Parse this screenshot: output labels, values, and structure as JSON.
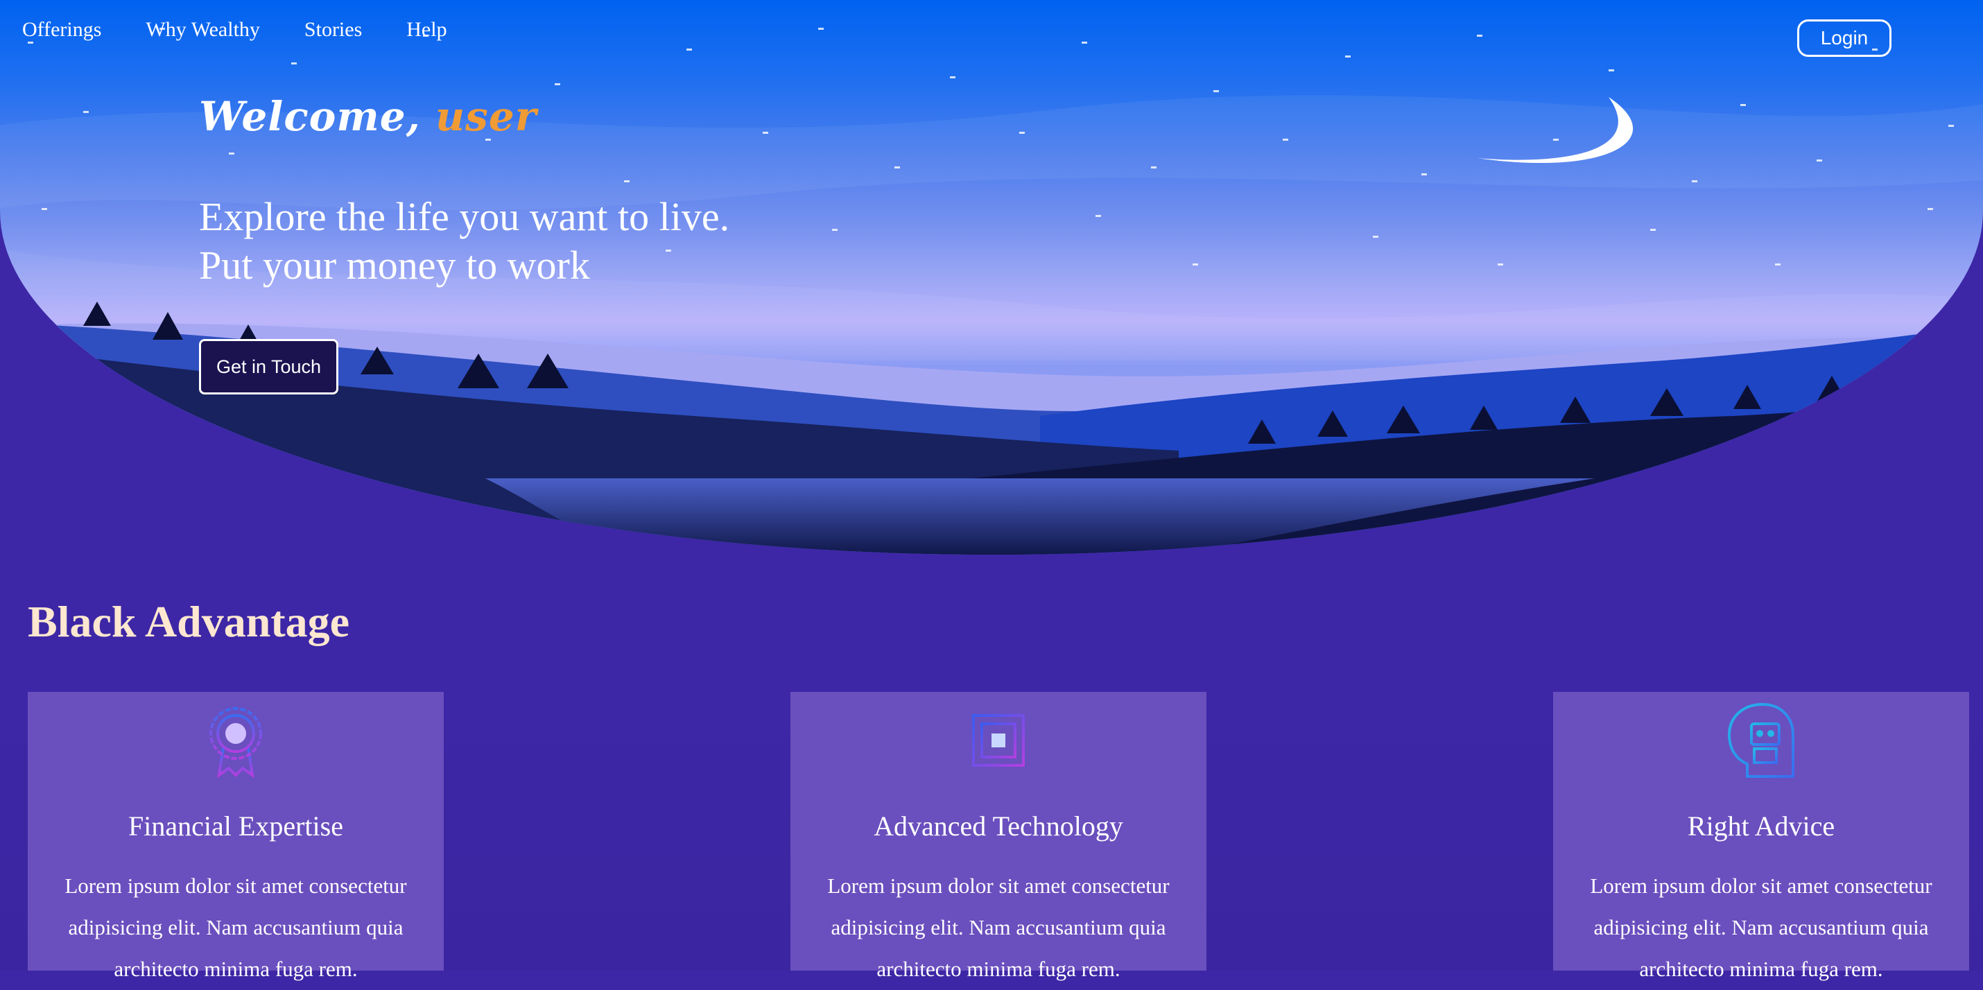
{
  "nav": {
    "items": [
      {
        "label": "Offerings"
      },
      {
        "label": "Why Wealthy"
      },
      {
        "label": "Stories"
      },
      {
        "label": "Help"
      }
    ],
    "login_label": "Login"
  },
  "hero": {
    "welcome_prefix": "Welcome,",
    "welcome_user": "user",
    "tagline_line1": "Explore the life you want to live.",
    "tagline_line2": "Put your money to work",
    "cta_label": "Get in Touch"
  },
  "section": {
    "title": "Black Advantage",
    "cards": [
      {
        "icon": "award-ribbon-icon",
        "title": "Financial Expertise",
        "text": "Lorem ipsum dolor sit amet consectetur adipisicing elit. Nam accusantium quia architecto minima fuga rem."
      },
      {
        "icon": "cpu-chip-icon",
        "title": "Advanced Technology",
        "text": "Lorem ipsum dolor sit amet consectetur adipisicing elit. Nam accusantium quia architecto minima fuga rem."
      },
      {
        "icon": "robot-head-icon",
        "title": "Right Advice",
        "text": "Lorem ipsum dolor sit amet consectetur adipisicing elit. Nam accusantium quia architecto minima fuga rem."
      }
    ]
  },
  "colors": {
    "page_background": "#3d27a6",
    "card_background": "#6a4fbe",
    "accent_user": "#f19b35",
    "section_title": "#fde7d0",
    "cta_background": "#1b1250"
  }
}
